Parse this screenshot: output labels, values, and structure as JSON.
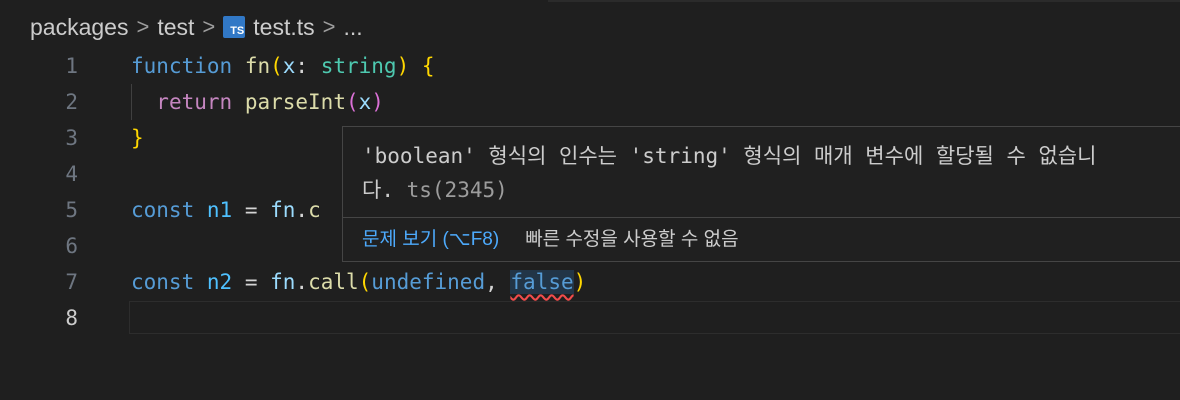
{
  "breadcrumb": {
    "items": [
      "packages",
      "test",
      "test.ts",
      "..."
    ],
    "separator": ">",
    "file_icon": "TS"
  },
  "editor": {
    "language": "typescript",
    "active_line": "8",
    "lines": [
      {
        "num": "1",
        "tokens": [
          {
            "t": "function",
            "c": "kw"
          },
          {
            "t": " "
          },
          {
            "t": "fn",
            "c": "fnc"
          },
          {
            "t": "(",
            "c": "br1"
          },
          {
            "t": "x",
            "c": "var"
          },
          {
            "t": ": "
          },
          {
            "t": "string",
            "c": "type"
          },
          {
            "t": ")",
            "c": "br1"
          },
          {
            "t": " "
          },
          {
            "t": "{",
            "c": "br1"
          }
        ]
      },
      {
        "num": "2",
        "tokens": [
          {
            "t": "  "
          },
          {
            "t": "return",
            "c": "kw2"
          },
          {
            "t": " "
          },
          {
            "t": "parseInt",
            "c": "fnc"
          },
          {
            "t": "(",
            "c": "br2"
          },
          {
            "t": "x",
            "c": "var"
          },
          {
            "t": ")",
            "c": "br2"
          }
        ]
      },
      {
        "num": "3",
        "tokens": [
          {
            "t": "}",
            "c": "br1"
          }
        ]
      },
      {
        "num": "4",
        "tokens": []
      },
      {
        "num": "5",
        "tokens": [
          {
            "t": "const",
            "c": "kw"
          },
          {
            "t": " "
          },
          {
            "t": "n1",
            "c": "num"
          },
          {
            "t": " = "
          },
          {
            "t": "fn",
            "c": "var"
          },
          {
            "t": "."
          },
          {
            "t": "c",
            "c": "fnc"
          }
        ]
      },
      {
        "num": "6",
        "tokens": []
      },
      {
        "num": "7",
        "tokens": [
          {
            "t": "const",
            "c": "kw"
          },
          {
            "t": " "
          },
          {
            "t": "n2",
            "c": "num"
          },
          {
            "t": " = "
          },
          {
            "t": "fn",
            "c": "var"
          },
          {
            "t": "."
          },
          {
            "t": "call",
            "c": "fnc"
          },
          {
            "t": "(",
            "c": "br1"
          },
          {
            "t": "undefined",
            "c": "kw"
          },
          {
            "t": ", "
          },
          {
            "t": "false",
            "c": "kw err"
          },
          {
            "t": ")",
            "c": "br1"
          }
        ]
      },
      {
        "num": "8",
        "tokens": []
      }
    ]
  },
  "hover": {
    "message_line1": "'boolean' 형식의 인수는 'string' 형식의 매개 변수에 할당될 수 없습니",
    "message_line2": "다.",
    "error_code": "ts(2345)",
    "view_problem": "문제 보기 (⌥F8)",
    "no_quick_fix": "빠른 수정을 사용할 수 없음"
  },
  "colors": {
    "background": "#1f1f1f",
    "keyword": "#569cd6",
    "control_keyword": "#c586c0",
    "function": "#dcdcaa",
    "variable": "#9cdcfe",
    "type": "#4ec9b0",
    "bracket1": "#ffd700",
    "bracket2": "#da70d6",
    "error": "#f14c4c",
    "link": "#4daafc"
  }
}
